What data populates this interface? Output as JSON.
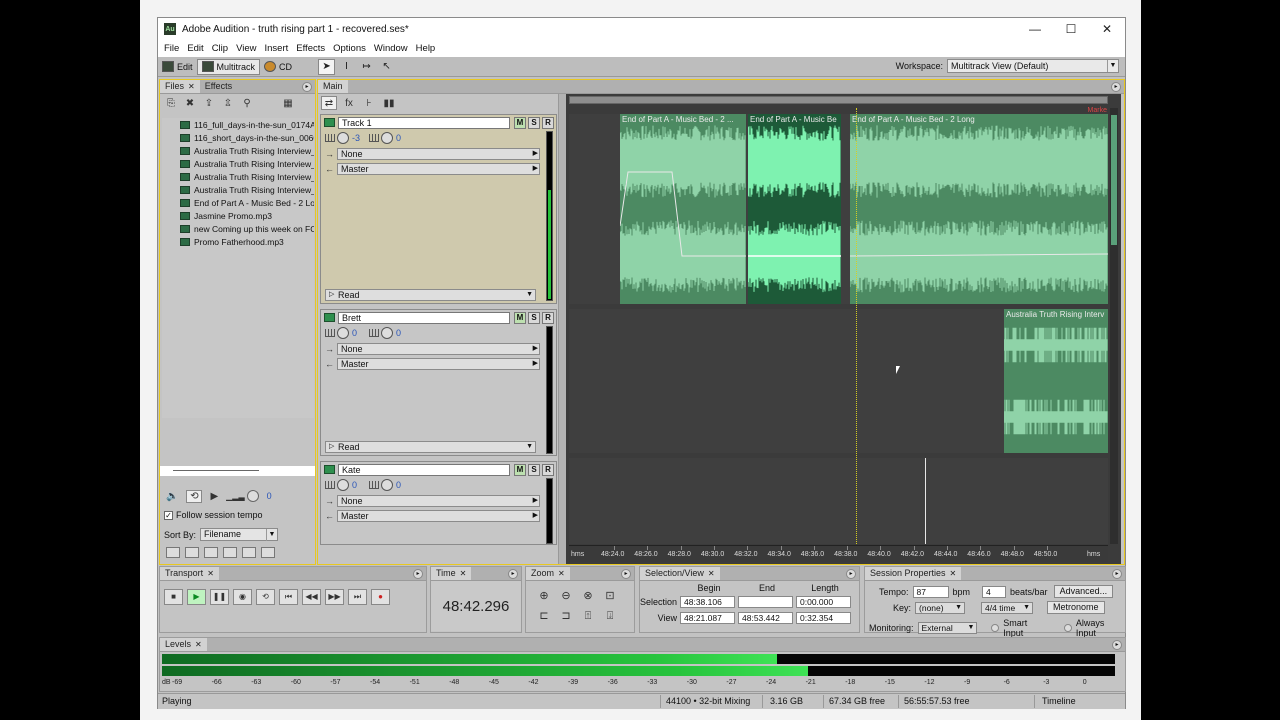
{
  "window": {
    "title": "Adobe Audition - truth rising part 1 - recovered.ses*",
    "app_icon": "Au",
    "minimize": "—",
    "maximize": "☐",
    "close": "✕"
  },
  "menu": [
    "File",
    "Edit",
    "Clip",
    "View",
    "Insert",
    "Effects",
    "Options",
    "Window",
    "Help"
  ],
  "toolbar": {
    "edit": "Edit",
    "multitrack": "Multitrack",
    "cd": "CD",
    "workspace_label": "Workspace:",
    "workspace_value": "Multitrack View (Default)"
  },
  "files_panel": {
    "tabs": [
      "Files",
      "Effects"
    ],
    "items": [
      "116_full_days-in-the-sun_0174A.",
      "116_short_days-in-the-sun_0060",
      "Australia Truth Rising Interview_E",
      "Australia Truth Rising Interview_",
      "Australia Truth Rising Interview_",
      "Australia Truth Rising Interview_",
      "End of Part A - Music Bed - 2 Lor",
      "Jasmine Promo.mp3",
      "new Coming up this week on FO",
      "Promo Fatherhood.mp3"
    ],
    "preview_vol": "0",
    "follow_label": "Follow session tempo",
    "follow_checked": "✓",
    "sort_label": "Sort By:",
    "sort_value": "Filename"
  },
  "main_panel": {
    "tab": "Main",
    "tracks": [
      {
        "name": "Track 1",
        "vol": "-3",
        "pan": "0",
        "input": "None",
        "output": "Master",
        "automation": "Read"
      },
      {
        "name": "Brett",
        "vol": "0",
        "pan": "0",
        "input": "None",
        "output": "Master",
        "automation": "Read"
      },
      {
        "name": "Kate",
        "vol": "0",
        "pan": "0",
        "input": "None",
        "output": "Master"
      }
    ],
    "msr": [
      "M",
      "S",
      "R"
    ],
    "clips": [
      "End of Part A - Music Bed - 2 ...",
      "End of Part A - Music Be",
      "End of Part A - Music Bed - 2 Long",
      "Australia Truth Rising Interv"
    ],
    "marker": "Marke",
    "ruler": [
      "hms",
      "48:24.0",
      "48:26.0",
      "48:28.0",
      "48:30.0",
      "48:32.0",
      "48:34.0",
      "48:36.0",
      "48:38.0",
      "48:40.0",
      "48:42.0",
      "48:44.0",
      "48:46.0",
      "48:48.0",
      "48:50.0",
      "hms"
    ]
  },
  "transport": {
    "tab": "Transport"
  },
  "time": {
    "tab": "Time",
    "value": "48:42.296"
  },
  "zoom": {
    "tab": "Zoom"
  },
  "selection_view": {
    "tab": "Selection/View",
    "headers": [
      "Begin",
      "End",
      "Length"
    ],
    "selection_label": "Selection",
    "selection": [
      "48:38.106",
      "",
      "0:00.000"
    ],
    "view_label": "View",
    "view": [
      "48:21.087",
      "48:53.442",
      "0:32.354"
    ]
  },
  "session": {
    "tab": "Session Properties",
    "tempo_label": "Tempo:",
    "tempo": "87",
    "bpm": "bpm",
    "beats": "4",
    "beats_label": "beats/bar",
    "advanced": "Advanced...",
    "key_label": "Key:",
    "key": "(none)",
    "timesig": "4/4 time",
    "metronome": "Metronome",
    "monitoring_label": "Monitoring:",
    "monitoring": "External",
    "smart_input": "Smart Input",
    "always_input": "Always Input"
  },
  "levels": {
    "tab": "Levels",
    "left_level": 0.645,
    "right_level": 0.678,
    "scale": [
      "dB",
      "-69",
      "-66",
      "-63",
      "-60",
      "-57",
      "-54",
      "-51",
      "-48",
      "-45",
      "-42",
      "-39",
      "-36",
      "-33",
      "-30",
      "-27",
      "-24",
      "-21",
      "-18",
      "-15",
      "-12",
      "-9",
      "-6",
      "-3",
      "0"
    ]
  },
  "status": {
    "state": "Playing",
    "format": "44100 • 32-bit Mixing",
    "size": "3.16 GB",
    "free": "67.34 GB free",
    "time_free": "56:55:57.53 free",
    "mode": "Timeline"
  }
}
